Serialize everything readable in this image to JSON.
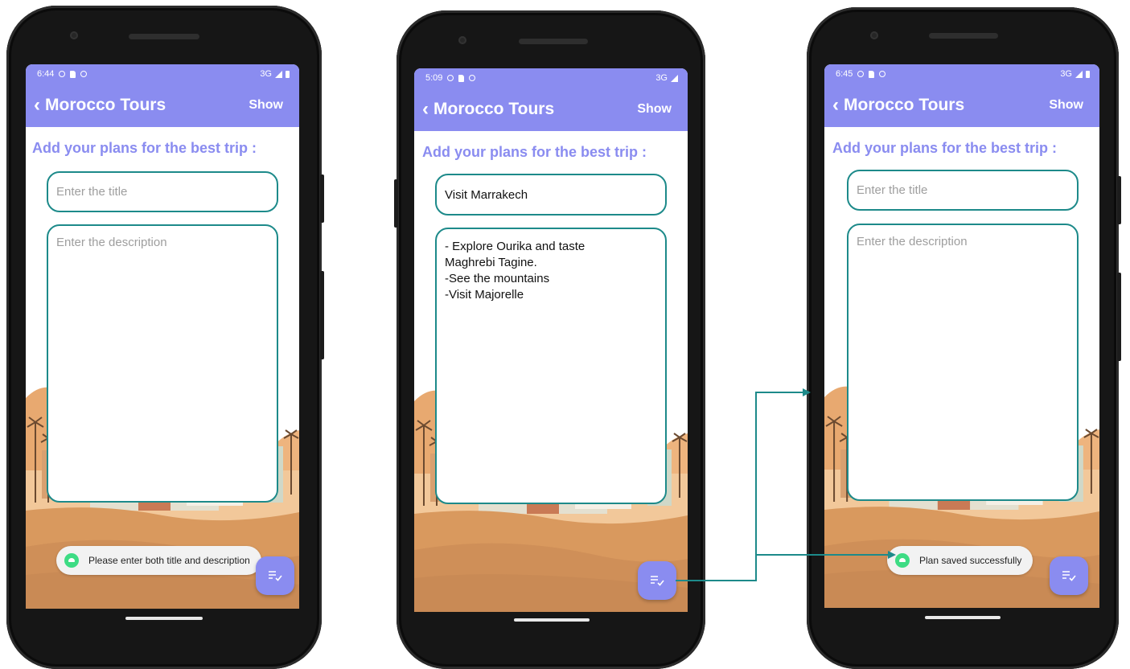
{
  "colors": {
    "accent": "#8a8cf0",
    "border": "#1d8a8a",
    "toast_icon": "#3ddc84"
  },
  "phones": [
    {
      "status_time": "6:44",
      "network": "3G",
      "back_icon": "chevron-left-icon",
      "title": "Morocco Tours",
      "show_label": "Show",
      "heading": "Add your plans for the best trip :",
      "title_placeholder": "Enter the title",
      "title_value": "",
      "desc_placeholder": "Enter the description",
      "desc_value": "",
      "fab_icon": "playlist-check-icon",
      "toast": "Please enter both title and description"
    },
    {
      "status_time": "5:09",
      "network": "3G",
      "back_icon": "chevron-left-icon",
      "title": "Morocco Tours",
      "show_label": "Show",
      "heading": "Add your plans for the best trip :",
      "title_placeholder": "Enter the title",
      "title_value": "Visit Marrakech",
      "desc_placeholder": "Enter the description",
      "desc_value": "- Explore Ourika and taste\nMaghrebi Tagine.\n-See the mountains\n-Visit Majorelle",
      "fab_icon": "playlist-check-icon",
      "toast": ""
    },
    {
      "status_time": "6:45",
      "network": "3G",
      "back_icon": "chevron-left-icon",
      "title": "Morocco Tours",
      "show_label": "Show",
      "heading": "Add your plans for the best trip :",
      "title_placeholder": "Enter the title",
      "title_value": "",
      "desc_placeholder": "Enter the description",
      "desc_value": "",
      "fab_icon": "playlist-check-icon",
      "toast": "Plan saved successfully"
    }
  ]
}
